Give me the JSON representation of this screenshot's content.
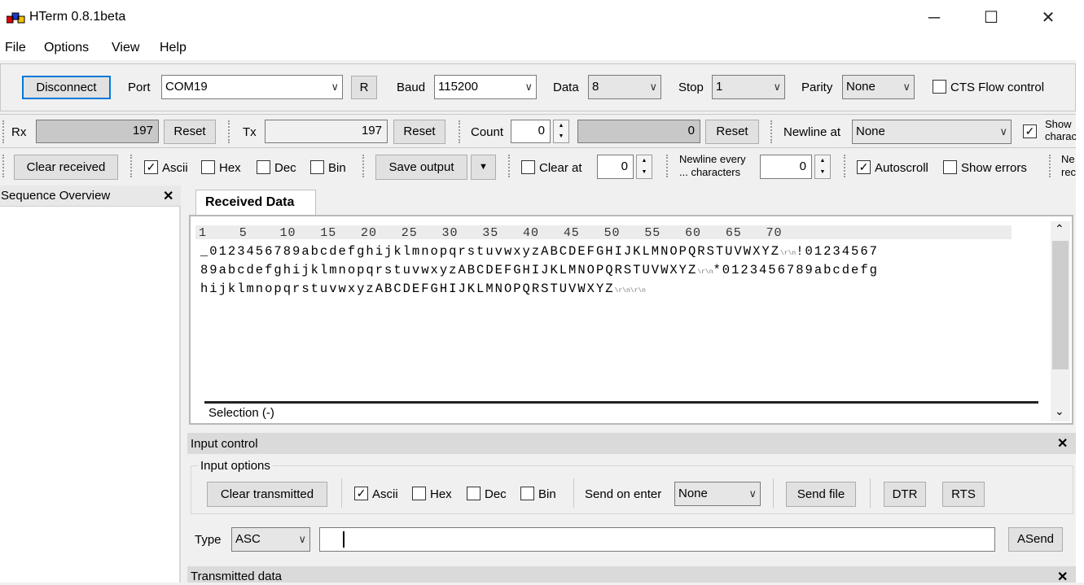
{
  "window": {
    "title": "HTerm 0.8.1beta",
    "min": "─",
    "max": "☐",
    "close": "✕"
  },
  "menu": [
    "File",
    "Options",
    "View",
    "Help"
  ],
  "conn": {
    "disconnect": "Disconnect",
    "port_label": "Port",
    "port_value": "COM19",
    "r_label": "R",
    "baud_label": "Baud",
    "baud_value": "115200",
    "data_label": "Data",
    "data_value": "8",
    "stop_label": "Stop",
    "stop_value": "1",
    "parity_label": "Parity",
    "parity_value": "None",
    "cts_label": "CTS Flow control"
  },
  "counters": {
    "rx_label": "Rx",
    "rx_value": "197",
    "rx_reset": "Reset",
    "tx_label": "Tx",
    "tx_value": "197",
    "tx_reset": "Reset",
    "count_label": "Count",
    "count_value": "0",
    "count_total": "0",
    "count_reset": "Reset",
    "newline_label": "Newline at",
    "newline_value": "None",
    "show_label": "Show",
    "show_label2": "charac"
  },
  "recv_opts": {
    "clear": "Clear received",
    "ascii": "Ascii",
    "hex": "Hex",
    "dec": "Dec",
    "bin": "Bin",
    "save": "Save output",
    "clear_at": "Clear at",
    "clear_at_value": "0",
    "nl_every_1": "Newline every",
    "nl_every_2": "... characters",
    "nl_every_value": "0",
    "autoscroll": "Autoscroll",
    "show_errors": "Show errors",
    "ne_1": "Ne",
    "ne_2": "rec"
  },
  "sequence": {
    "title": "Sequence Overview",
    "close": "✕"
  },
  "received": {
    "tab": "Received Data",
    "ruler": "1    5    10   15   20   25   30   35   40   45   50   55   60   65   70",
    "lines": [
      {
        "text": "_0123456789abcdefghijklmnopqrstuvwxyzABCDEFGHIJKLMNOPQRSTUVWXYZ",
        "ctl": "\\r\\n",
        "tail": "!01234567"
      },
      {
        "text": "89abcdefghijklmnopqrstuvwxyzABCDEFGHIJKLMNOPQRSTUVWXYZ",
        "ctl": "\\r\\n",
        "tail": "*0123456789abcdefg"
      },
      {
        "text": "hijklmnopqrstuvwxyzABCDEFGHIJKLMNOPQRSTUVWXYZ",
        "ctl": "\\r\\n\\r\\n",
        "tail": ""
      }
    ],
    "selection": "Selection (-)"
  },
  "input": {
    "title": "Input control",
    "close": "✕",
    "group": "Input options",
    "clear": "Clear transmitted",
    "ascii": "Ascii",
    "hex": "Hex",
    "dec": "Dec",
    "bin": "Bin",
    "send_on_enter_label": "Send on enter",
    "send_on_enter_value": "None",
    "send_file": "Send file",
    "dtr": "DTR",
    "rts": "RTS",
    "type_label": "Type",
    "type_value": "ASC",
    "input_value": "",
    "asend": "ASend"
  },
  "transmitted": {
    "title": "Transmitted data",
    "close": "✕"
  }
}
